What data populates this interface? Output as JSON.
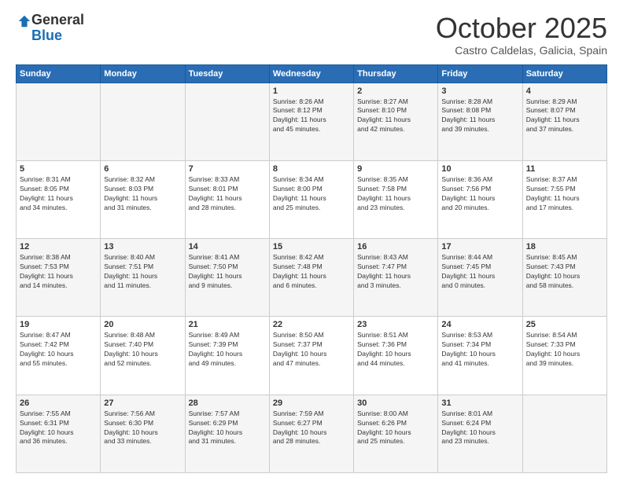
{
  "logo": {
    "general": "General",
    "blue": "Blue"
  },
  "header": {
    "month": "October 2025",
    "location": "Castro Caldelas, Galicia, Spain"
  },
  "weekdays": [
    "Sunday",
    "Monday",
    "Tuesday",
    "Wednesday",
    "Thursday",
    "Friday",
    "Saturday"
  ],
  "weeks": [
    [
      {
        "day": "",
        "info": ""
      },
      {
        "day": "",
        "info": ""
      },
      {
        "day": "",
        "info": ""
      },
      {
        "day": "1",
        "info": "Sunrise: 8:26 AM\nSunset: 8:12 PM\nDaylight: 11 hours\nand 45 minutes."
      },
      {
        "day": "2",
        "info": "Sunrise: 8:27 AM\nSunset: 8:10 PM\nDaylight: 11 hours\nand 42 minutes."
      },
      {
        "day": "3",
        "info": "Sunrise: 8:28 AM\nSunset: 8:08 PM\nDaylight: 11 hours\nand 39 minutes."
      },
      {
        "day": "4",
        "info": "Sunrise: 8:29 AM\nSunset: 8:07 PM\nDaylight: 11 hours\nand 37 minutes."
      }
    ],
    [
      {
        "day": "5",
        "info": "Sunrise: 8:31 AM\nSunset: 8:05 PM\nDaylight: 11 hours\nand 34 minutes."
      },
      {
        "day": "6",
        "info": "Sunrise: 8:32 AM\nSunset: 8:03 PM\nDaylight: 11 hours\nand 31 minutes."
      },
      {
        "day": "7",
        "info": "Sunrise: 8:33 AM\nSunset: 8:01 PM\nDaylight: 11 hours\nand 28 minutes."
      },
      {
        "day": "8",
        "info": "Sunrise: 8:34 AM\nSunset: 8:00 PM\nDaylight: 11 hours\nand 25 minutes."
      },
      {
        "day": "9",
        "info": "Sunrise: 8:35 AM\nSunset: 7:58 PM\nDaylight: 11 hours\nand 23 minutes."
      },
      {
        "day": "10",
        "info": "Sunrise: 8:36 AM\nSunset: 7:56 PM\nDaylight: 11 hours\nand 20 minutes."
      },
      {
        "day": "11",
        "info": "Sunrise: 8:37 AM\nSunset: 7:55 PM\nDaylight: 11 hours\nand 17 minutes."
      }
    ],
    [
      {
        "day": "12",
        "info": "Sunrise: 8:38 AM\nSunset: 7:53 PM\nDaylight: 11 hours\nand 14 minutes."
      },
      {
        "day": "13",
        "info": "Sunrise: 8:40 AM\nSunset: 7:51 PM\nDaylight: 11 hours\nand 11 minutes."
      },
      {
        "day": "14",
        "info": "Sunrise: 8:41 AM\nSunset: 7:50 PM\nDaylight: 11 hours\nand 9 minutes."
      },
      {
        "day": "15",
        "info": "Sunrise: 8:42 AM\nSunset: 7:48 PM\nDaylight: 11 hours\nand 6 minutes."
      },
      {
        "day": "16",
        "info": "Sunrise: 8:43 AM\nSunset: 7:47 PM\nDaylight: 11 hours\nand 3 minutes."
      },
      {
        "day": "17",
        "info": "Sunrise: 8:44 AM\nSunset: 7:45 PM\nDaylight: 11 hours\nand 0 minutes."
      },
      {
        "day": "18",
        "info": "Sunrise: 8:45 AM\nSunset: 7:43 PM\nDaylight: 10 hours\nand 58 minutes."
      }
    ],
    [
      {
        "day": "19",
        "info": "Sunrise: 8:47 AM\nSunset: 7:42 PM\nDaylight: 10 hours\nand 55 minutes."
      },
      {
        "day": "20",
        "info": "Sunrise: 8:48 AM\nSunset: 7:40 PM\nDaylight: 10 hours\nand 52 minutes."
      },
      {
        "day": "21",
        "info": "Sunrise: 8:49 AM\nSunset: 7:39 PM\nDaylight: 10 hours\nand 49 minutes."
      },
      {
        "day": "22",
        "info": "Sunrise: 8:50 AM\nSunset: 7:37 PM\nDaylight: 10 hours\nand 47 minutes."
      },
      {
        "day": "23",
        "info": "Sunrise: 8:51 AM\nSunset: 7:36 PM\nDaylight: 10 hours\nand 44 minutes."
      },
      {
        "day": "24",
        "info": "Sunrise: 8:53 AM\nSunset: 7:34 PM\nDaylight: 10 hours\nand 41 minutes."
      },
      {
        "day": "25",
        "info": "Sunrise: 8:54 AM\nSunset: 7:33 PM\nDaylight: 10 hours\nand 39 minutes."
      }
    ],
    [
      {
        "day": "26",
        "info": "Sunrise: 7:55 AM\nSunset: 6:31 PM\nDaylight: 10 hours\nand 36 minutes."
      },
      {
        "day": "27",
        "info": "Sunrise: 7:56 AM\nSunset: 6:30 PM\nDaylight: 10 hours\nand 33 minutes."
      },
      {
        "day": "28",
        "info": "Sunrise: 7:57 AM\nSunset: 6:29 PM\nDaylight: 10 hours\nand 31 minutes."
      },
      {
        "day": "29",
        "info": "Sunrise: 7:59 AM\nSunset: 6:27 PM\nDaylight: 10 hours\nand 28 minutes."
      },
      {
        "day": "30",
        "info": "Sunrise: 8:00 AM\nSunset: 6:26 PM\nDaylight: 10 hours\nand 25 minutes."
      },
      {
        "day": "31",
        "info": "Sunrise: 8:01 AM\nSunset: 6:24 PM\nDaylight: 10 hours\nand 23 minutes."
      },
      {
        "day": "",
        "info": ""
      }
    ]
  ]
}
